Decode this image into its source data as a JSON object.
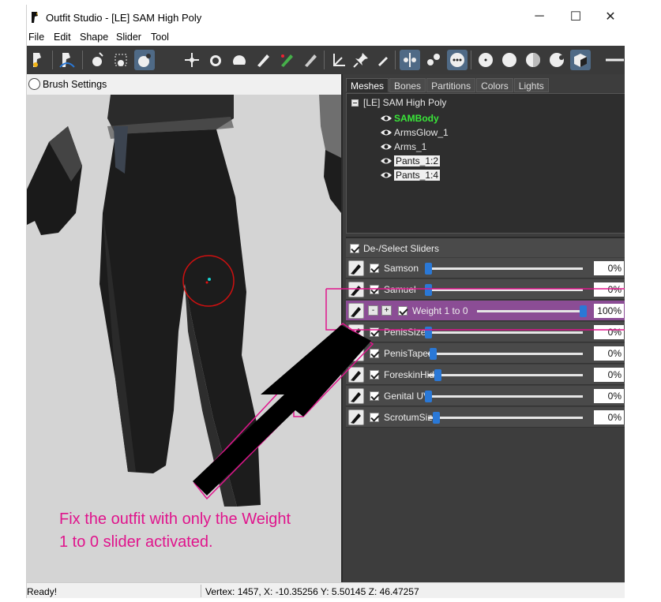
{
  "window": {
    "title": "Outfit Studio - [LE] SAM High Poly",
    "controls": {
      "minimize": "─",
      "maximize": "☐",
      "close": "✕"
    }
  },
  "menu": [
    "File",
    "Edit",
    "Shape",
    "Slider",
    "Tool"
  ],
  "toolbar": {
    "icons": [
      "brush-shape-icon",
      "brush-inflate-icon",
      "brush-select-icon",
      "brush-rect-select-icon",
      "brush-move-icon",
      "brush-smooth-icon",
      "brush-transform-icon",
      "brush-deflate-icon",
      "brush-undiff-icon",
      "brush-paint-icon",
      "brush-weight-icon",
      "brush-color-icon",
      "brush-alpha-icon",
      "axis-icon",
      "pin-icon",
      "eyedropper-icon",
      "mirror-icon",
      "connected-icon",
      "vertex-icon",
      "sphere-icon",
      "sphere-solid-icon",
      "sphere-half-icon",
      "sphere-lit-icon",
      "cube-icon"
    ]
  },
  "brush_settings": {
    "label": "Brush Settings"
  },
  "panel": {
    "tabs": [
      {
        "label": "Meshes",
        "selected": true
      },
      {
        "label": "Bones",
        "selected": false
      },
      {
        "label": "Partitions",
        "selected": false
      },
      {
        "label": "Colors",
        "selected": false
      },
      {
        "label": "Lights",
        "selected": false
      }
    ],
    "project": "[LE] SAM High Poly",
    "meshes": [
      {
        "name": "SAMBody",
        "state": "active"
      },
      {
        "name": "ArmsGlow_1",
        "state": "normal"
      },
      {
        "name": "Arms_1",
        "state": "normal"
      },
      {
        "name": "Pants_1:2",
        "state": "highlight"
      },
      {
        "name": "Pants_1:4",
        "state": "highlight"
      }
    ]
  },
  "sliders": {
    "header": "De-/Select Sliders",
    "items": [
      {
        "name": "Samson",
        "value": "0%",
        "level": 0.0
      },
      {
        "name": "Samuel",
        "value": "0%",
        "level": 0.0
      },
      {
        "name": "Weight 1 to 0",
        "value": "100%",
        "level": 1.0,
        "active": true,
        "minus": "-",
        "plus": "+"
      },
      {
        "name": "PenisSize",
        "value": "0%",
        "level": 0.0
      },
      {
        "name": "PenisTaper",
        "value": "0%",
        "level": 0.03
      },
      {
        "name": "ForeskinHide",
        "value": "0%",
        "level": 0.06
      },
      {
        "name": "Genital UV",
        "value": "0%",
        "level": 0.0
      },
      {
        "name": "ScrotumSize",
        "value": "0%",
        "level": 0.05
      }
    ]
  },
  "status": {
    "left": "Ready!",
    "right": "Vertex: 1457, X: -10.35256 Y: 5.50145 Z: 46.47257"
  },
  "annotation": {
    "caption": "Fix the outfit with only the Weight 1 to 0 slider activated.",
    "color": "#e0148c"
  }
}
